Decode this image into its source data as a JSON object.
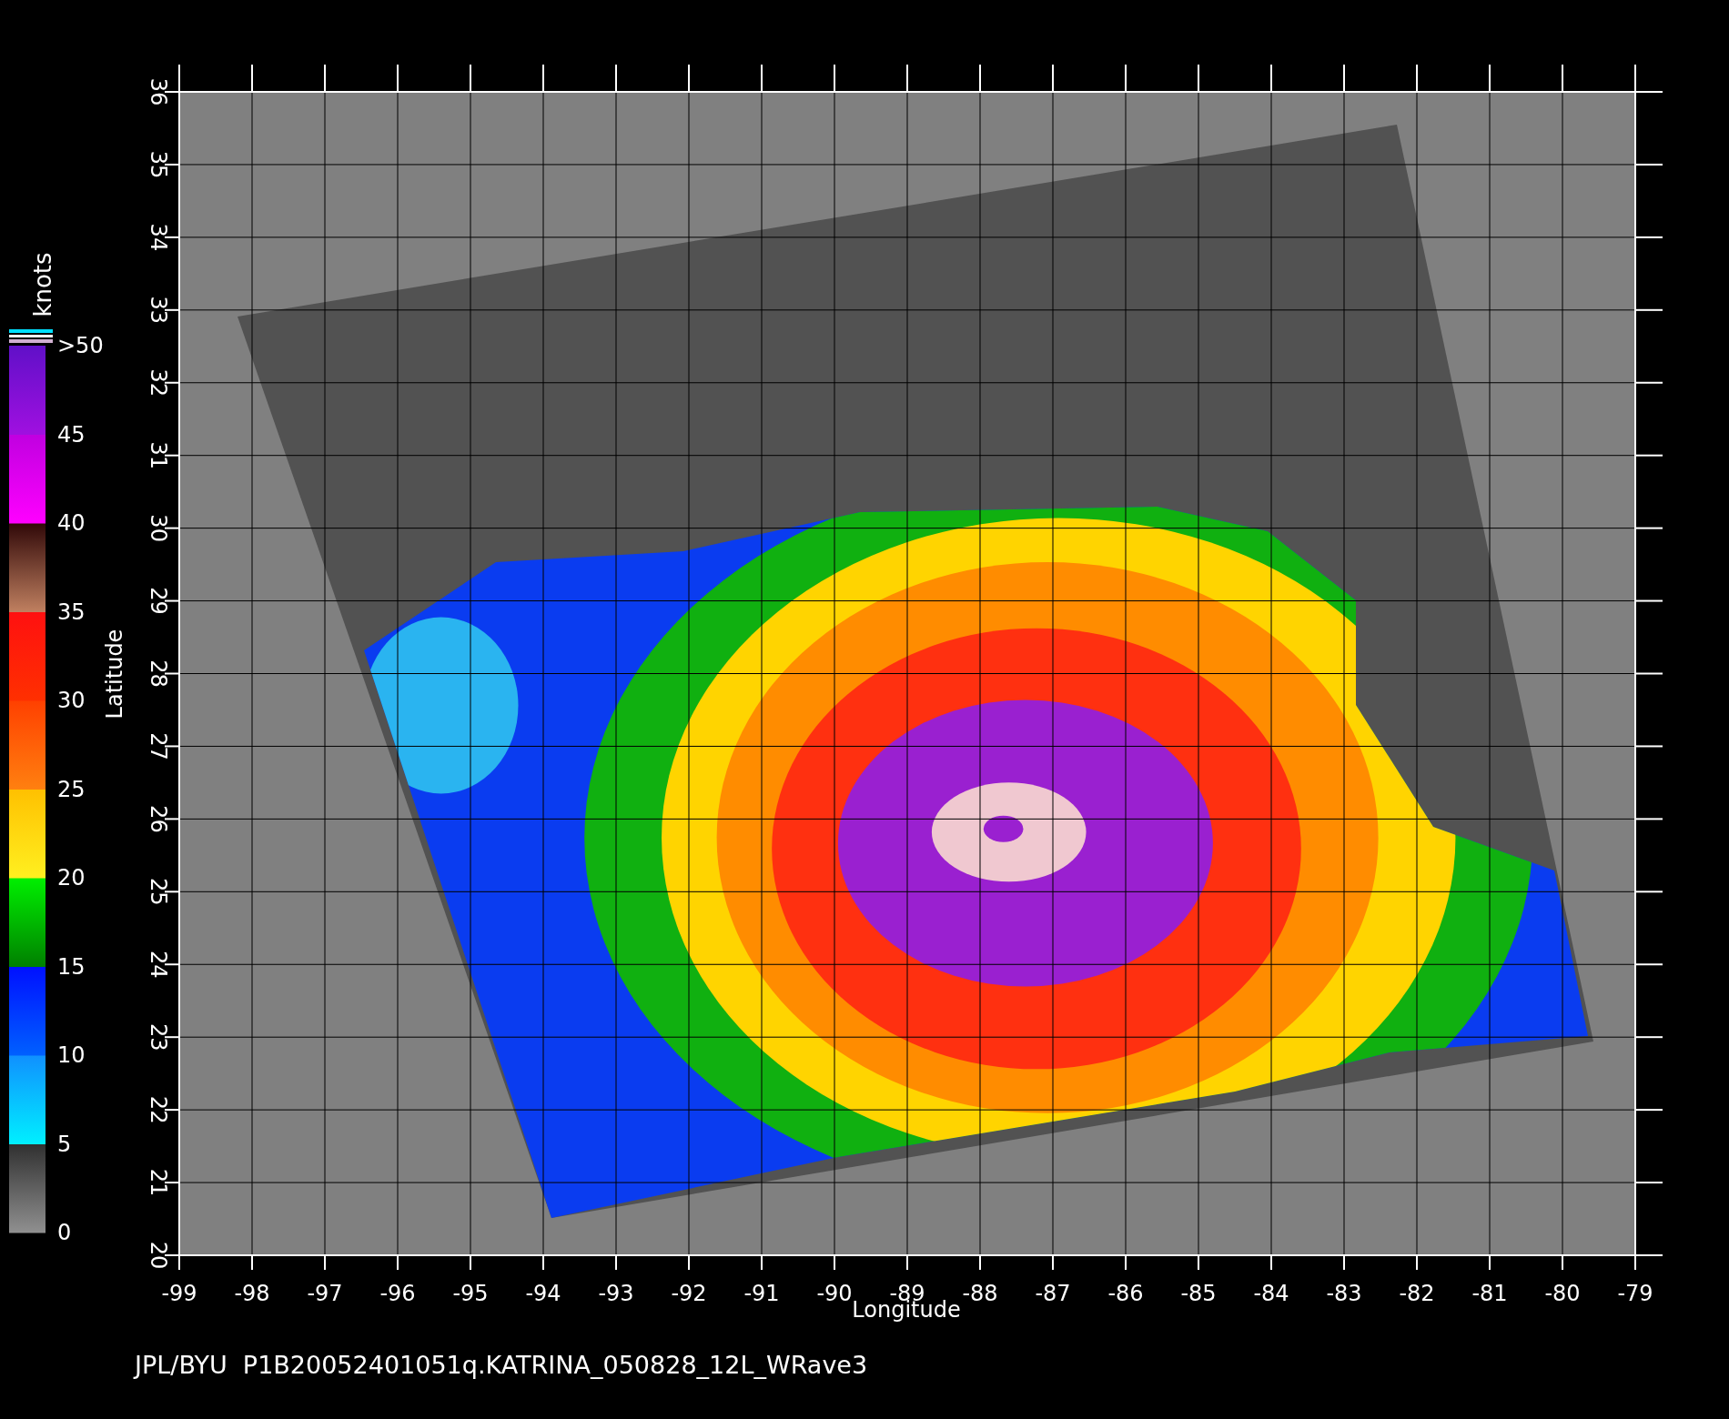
{
  "plot": {
    "x_label": "Longitude",
    "y_label": "Latitude",
    "x_ticks": [
      "-99",
      "-98",
      "-97",
      "-96",
      "-95",
      "-94",
      "-93",
      "-92",
      "-91",
      "-90",
      "-89",
      "-88",
      "-87",
      "-86",
      "-85",
      "-84",
      "-83",
      "-82",
      "-81",
      "-80",
      "-79"
    ],
    "y_ticks": [
      "20",
      "21",
      "22",
      "23",
      "24",
      "25",
      "26",
      "27",
      "28",
      "29",
      "30",
      "31",
      "32",
      "33",
      "34",
      "35",
      "36"
    ]
  },
  "colorbar": {
    "unit": "knots",
    "ticks": [
      ">50",
      "45",
      "40",
      "35",
      "30",
      "25",
      "20",
      "15",
      "10",
      "5",
      "0"
    ]
  },
  "footer": "JPL/BYU  P1B20052401051q.KATRINA_050828_12L_WRave3"
}
